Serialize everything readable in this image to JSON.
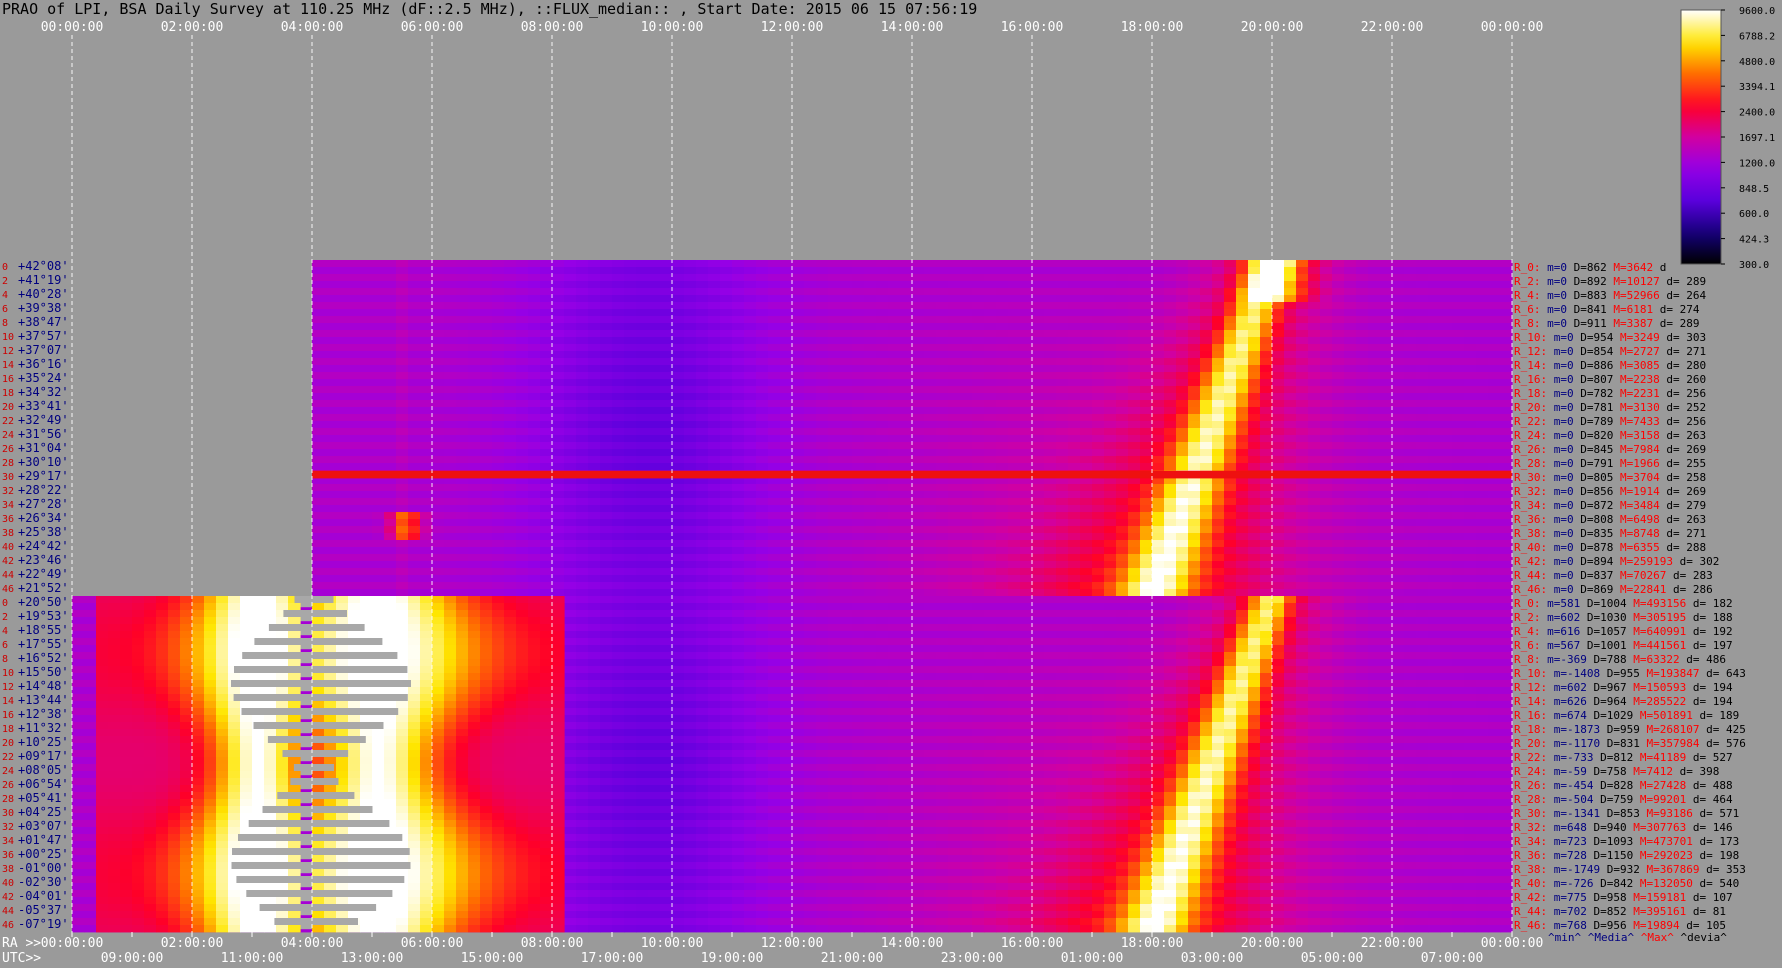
{
  "title": "PRAO of LPI, BSA Daily Survey at 110.25 MHz (dF::2.5 MHz), ::FLUX_median:: , Start Date: 2015 06 15 07:56:19",
  "colors": {
    "background": "#9a9a9a",
    "grid": "#ffffff",
    "declination_text": "#000080",
    "beam_index_text": "#cc0000",
    "stats_R_text": "#ff0000",
    "stats_m_text": "#000080",
    "stats_M_text": "#ff0000"
  },
  "chart_data": {
    "type": "heatmap",
    "title": "PRAO of LPI, BSA Daily Survey at 110.25 MHz (dF::2.5 MHz), ::FLUX_median:: , Start Date: 2015 06 15 07:56:19",
    "colorbar": {
      "ticks": [
        "9600.0",
        "6788.2",
        "4800.0",
        "3394.1",
        "2400.0",
        "1697.1",
        "1200.0",
        "848.5",
        "600.0",
        "424.3",
        "300.0"
      ],
      "range": [
        300,
        9600
      ],
      "scale": "log"
    },
    "top_axis_labels": [
      "00:00:00",
      "02:00:00",
      "04:00:00",
      "06:00:00",
      "08:00:00",
      "10:00:00",
      "12:00:00",
      "14:00:00",
      "16:00:00",
      "18:00:00",
      "20:00:00",
      "22:00:00",
      "00:00:00"
    ],
    "bottom_ra_prefix": "RA >>",
    "bottom_ra_labels": [
      "00:00:00",
      "02:00:00",
      "04:00:00",
      "06:00:00",
      "08:00:00",
      "10:00:00",
      "12:00:00",
      "14:00:00",
      "16:00:00",
      "18:00:00",
      "20:00:00",
      "22:00:00",
      "00:00:00"
    ],
    "bottom_utc_prefix": "UTC>>",
    "bottom_utc_labels": [
      "09:00:00",
      "11:00:00",
      "13:00:00",
      "15:00:00",
      "17:00:00",
      "19:00:00",
      "21:00:00",
      "23:00:00",
      "01:00:00",
      "03:00:00",
      "05:00:00",
      "07:00:00"
    ],
    "upper_block_declinations": [
      "+42°08'",
      "+41°19'",
      "+40°28'",
      "+39°38'",
      "+38°47'",
      "+37°57'",
      "+37°07'",
      "+36°16'",
      "+35°24'",
      "+34°32'",
      "+33°41'",
      "+32°49'",
      "+31°56'",
      "+31°04'",
      "+30°10'",
      "+29°17'",
      "+28°22'",
      "+27°28'",
      "+26°34'",
      "+25°38'",
      "+24°42'",
      "+23°46'",
      "+22°49'",
      "+21°52'"
    ],
    "lower_block_declinations": [
      "+20°50'",
      "+19°53'",
      "+18°55'",
      "+17°55'",
      "+16°52'",
      "+15°50'",
      "+14°48'",
      "+13°44'",
      "+12°38'",
      "+11°32'",
      "+10°25'",
      "+09°17'",
      "+08°05'",
      "+06°54'",
      "+05°41'",
      "+04°25'",
      "+03°07'",
      "+01°47'",
      "+00°25'",
      "-01°00'",
      "-02°30'",
      "-04°01'",
      "-05°37'",
      "-07°19'"
    ],
    "upper_block_beams": [
      "0",
      "2",
      "4",
      "6",
      "8",
      "10",
      "12",
      "14",
      "16",
      "18",
      "20",
      "22",
      "24",
      "26",
      "28",
      "30",
      "32",
      "34",
      "36",
      "38",
      "40",
      "42",
      "44",
      "46"
    ],
    "lower_block_beams": [
      "0",
      "2",
      "4",
      "6",
      "8",
      "10",
      "12",
      "14",
      "16",
      "18",
      "20",
      "22",
      "24",
      "26",
      "28",
      "30",
      "32",
      "34",
      "36",
      "38",
      "40",
      "42",
      "44",
      "46"
    ],
    "stats_upper": [
      {
        "r": "R_0:",
        "m": "m=0",
        "d": "D=862",
        "M": "M=3642",
        "dev": "d"
      },
      {
        "r": "R_2:",
        "m": "m=0",
        "d": "D=892",
        "M": "M=10127",
        "dev": "d= 289"
      },
      {
        "r": "R_4:",
        "m": "m=0",
        "d": "D=883",
        "M": "M=52966",
        "dev": "d= 264"
      },
      {
        "r": "R_6:",
        "m": "m=0",
        "d": "D=841",
        "M": "M=6181",
        "dev": "d= 274"
      },
      {
        "r": "R_8:",
        "m": "m=0",
        "d": "D=911",
        "M": "M=3387",
        "dev": "d= 289"
      },
      {
        "r": "R_10:",
        "m": "m=0",
        "d": "D=954",
        "M": "M=3249",
        "dev": "d= 303"
      },
      {
        "r": "R_12:",
        "m": "m=0",
        "d": "D=854",
        "M": "M=2727",
        "dev": "d= 271"
      },
      {
        "r": "R_14:",
        "m": "m=0",
        "d": "D=886",
        "M": "M=3085",
        "dev": "d= 280"
      },
      {
        "r": "R_16:",
        "m": "m=0",
        "d": "D=807",
        "M": "M=2238",
        "dev": "d= 260"
      },
      {
        "r": "R_18:",
        "m": "m=0",
        "d": "D=782",
        "M": "M=2231",
        "dev": "d= 256"
      },
      {
        "r": "R_20:",
        "m": "m=0",
        "d": "D=781",
        "M": "M=3130",
        "dev": "d= 252"
      },
      {
        "r": "R_22:",
        "m": "m=0",
        "d": "D=789",
        "M": "M=7433",
        "dev": "d= 256"
      },
      {
        "r": "R_24:",
        "m": "m=0",
        "d": "D=820",
        "M": "M=3158",
        "dev": "d= 263"
      },
      {
        "r": "R_26:",
        "m": "m=0",
        "d": "D=845",
        "M": "M=7984",
        "dev": "d= 269"
      },
      {
        "r": "R_28:",
        "m": "m=0",
        "d": "D=791",
        "M": "M=1966",
        "dev": "d= 255"
      },
      {
        "r": "R_30:",
        "m": "m=0",
        "d": "D=805",
        "M": "M=3704",
        "dev": "d= 258"
      },
      {
        "r": "R_32:",
        "m": "m=0",
        "d": "D=856",
        "M": "M=1914",
        "dev": "d= 269"
      },
      {
        "r": "R_34:",
        "m": "m=0",
        "d": "D=872",
        "M": "M=3484",
        "dev": "d= 279"
      },
      {
        "r": "R_36:",
        "m": "m=0",
        "d": "D=808",
        "M": "M=6498",
        "dev": "d= 263"
      },
      {
        "r": "R_38:",
        "m": "m=0",
        "d": "D=835",
        "M": "M=8748",
        "dev": "d= 271"
      },
      {
        "r": "R_40:",
        "m": "m=0",
        "d": "D=878",
        "M": "M=6355",
        "dev": "d= 288"
      },
      {
        "r": "R_42:",
        "m": "m=0",
        "d": "D=894",
        "M": "M=259193",
        "dev": "d= 302"
      },
      {
        "r": "R_44:",
        "m": "m=0",
        "d": "D=837",
        "M": "M=70267",
        "dev": "d= 283"
      },
      {
        "r": "R_46:",
        "m": "m=0",
        "d": "D=869",
        "M": "M=22841",
        "dev": "d= 286"
      }
    ],
    "stats_lower": [
      {
        "r": "R_0:",
        "m": "m=581",
        "d": "D=1004",
        "M": "M=493156",
        "dev": "d= 182"
      },
      {
        "r": "R_2:",
        "m": "m=602",
        "d": "D=1030",
        "M": "M=305195",
        "dev": "d= 188"
      },
      {
        "r": "R_4:",
        "m": "m=616",
        "d": "D=1057",
        "M": "M=640991",
        "dev": "d= 192"
      },
      {
        "r": "R_6:",
        "m": "m=567",
        "d": "D=1001",
        "M": "M=441561",
        "dev": "d= 197"
      },
      {
        "r": "R_8:",
        "m": "m=-369",
        "d": "D=788",
        "M": "M=63322",
        "dev": "d= 486"
      },
      {
        "r": "R_10:",
        "m": "m=-1408",
        "d": "D=955",
        "M": "M=193847",
        "dev": "d= 643"
      },
      {
        "r": "R_12:",
        "m": "m=602",
        "d": "D=967",
        "M": "M=150593",
        "dev": "d= 194"
      },
      {
        "r": "R_14:",
        "m": "m=626",
        "d": "D=964",
        "M": "M=285522",
        "dev": "d= 194"
      },
      {
        "r": "R_16:",
        "m": "m=674",
        "d": "D=1029",
        "M": "M=501891",
        "dev": "d= 189"
      },
      {
        "r": "R_18:",
        "m": "m=-1873",
        "d": "D=959",
        "M": "M=268107",
        "dev": "d= 425"
      },
      {
        "r": "R_20:",
        "m": "m=-1170",
        "d": "D=831",
        "M": "M=357984",
        "dev": "d= 576"
      },
      {
        "r": "R_22:",
        "m": "m=-733",
        "d": "D=812",
        "M": "M=41189",
        "dev": "d= 527"
      },
      {
        "r": "R_24:",
        "m": "m=-59",
        "d": "D=758",
        "M": "M=7412",
        "dev": "d= 398"
      },
      {
        "r": "R_26:",
        "m": "m=-454",
        "d": "D=828",
        "M": "M=27428",
        "dev": "d= 488"
      },
      {
        "r": "R_28:",
        "m": "m=-504",
        "d": "D=759",
        "M": "M=99201",
        "dev": "d= 464"
      },
      {
        "r": "R_30:",
        "m": "m=-1341",
        "d": "D=853",
        "M": "M=93186",
        "dev": "d= 571"
      },
      {
        "r": "R_32:",
        "m": "m=648",
        "d": "D=940",
        "M": "M=307763",
        "dev": "d= 146"
      },
      {
        "r": "R_34:",
        "m": "m=723",
        "d": "D=1093",
        "M": "M=473701",
        "dev": "d= 173"
      },
      {
        "r": "R_36:",
        "m": "m=728",
        "d": "D=1150",
        "M": "M=292023",
        "dev": "d= 198"
      },
      {
        "r": "R_38:",
        "m": "m=-1749",
        "d": "D=932",
        "M": "M=367869",
        "dev": "d= 353"
      },
      {
        "r": "R_40:",
        "m": "m=-726",
        "d": "D=842",
        "M": "M=132050",
        "dev": "d= 540"
      },
      {
        "r": "R_42:",
        "m": "m=775",
        "d": "D=958",
        "M": "M=159181",
        "dev": "d= 107"
      },
      {
        "r": "R_44:",
        "m": "m=702",
        "d": "D=852",
        "M": "M=395161",
        "dev": "d= 81"
      },
      {
        "r": "R_46:",
        "m": "m=768",
        "d": "D=956",
        "M": "M=19894",
        "dev": "d= 105"
      }
    ],
    "stats_footer": {
      "min": "^min^",
      "median": "^Media^",
      "max": "^Max^",
      "dev": "^devia^"
    },
    "features": {
      "upper_block_ra_start": "04:00:00",
      "lower_block_ra_start": "00:00:00",
      "milky_way_ra_start_at_top": "20:00:00",
      "milky_way_ra_end_at_bottom": "18:00:00",
      "strong_source_ra": "05:34:00",
      "rfi_row_upper_beam": "30"
    }
  }
}
